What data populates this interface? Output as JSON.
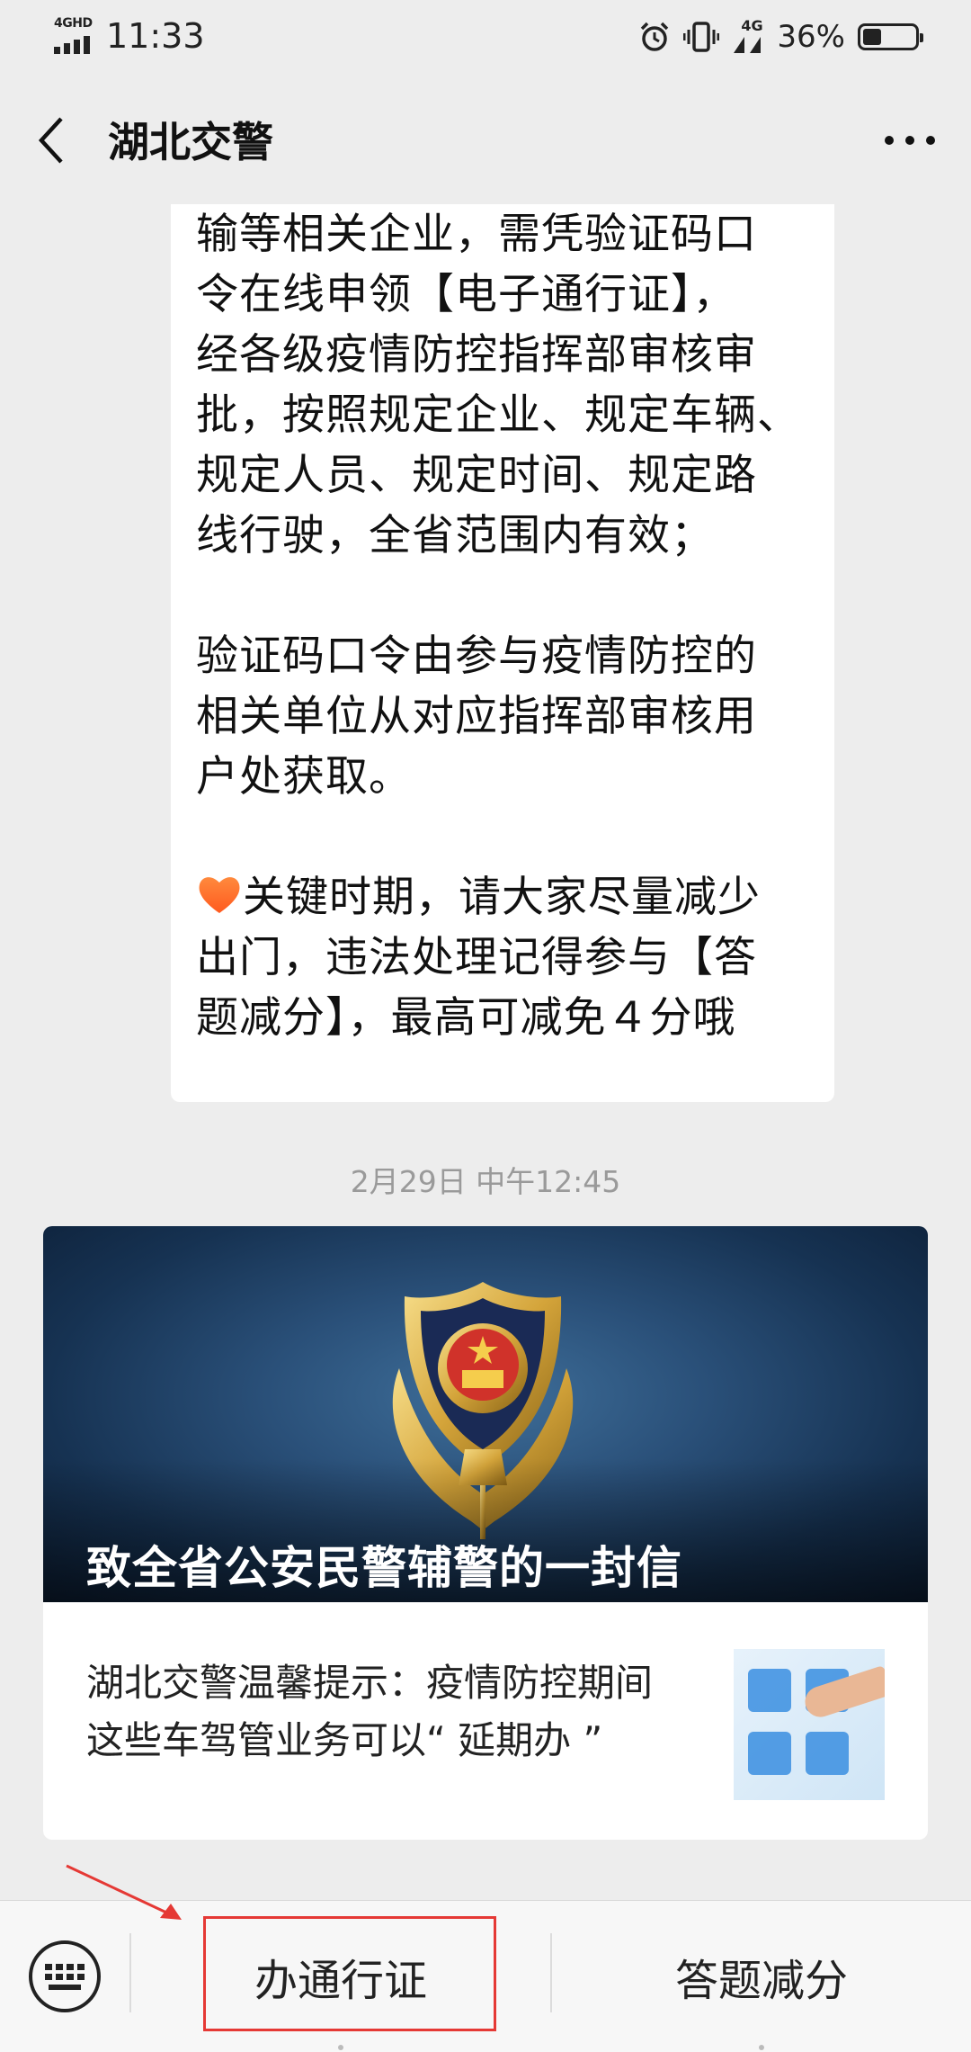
{
  "status_bar": {
    "network_label": "4GHD",
    "time": "11:33",
    "signal_label": "4G",
    "battery_percent": "36%",
    "battery_level": 0.36,
    "icons": [
      "alarm-icon",
      "vibrate-icon",
      "signal-icon",
      "battery-icon"
    ]
  },
  "nav": {
    "title": "湖北交警"
  },
  "message": {
    "lines": [
      "输等相关企业，需凭验证码口",
      "令在线申领【电子通行证】，",
      "经各级疫情防控指挥部审核审",
      "批，按照规定企业、规定车辆、",
      "规定人员、规定时间、规定路",
      "线行驶，全省范围内有效；"
    ],
    "para2_lines": [
      " 验证码口令由参与疫情防控的",
      "相关单位从对应指挥部审核用",
      "户处获取。"
    ],
    "para3_first": "关键时期，请大家尽量减少",
    "para3_lines": [
      "出门，违法处理记得参与【答",
      "题减分】，最高可减免４分哦"
    ]
  },
  "timestamp": "2月29日 中午12:45",
  "article": {
    "cover_title": "致全省公安民警辅警的一封信",
    "sub_title_line1": "湖北交警温馨提示：疫情防控期间",
    "sub_title_line2": "这些车驾管业务可以“ 延期办 ”"
  },
  "bottom_menu": {
    "items": [
      "办通行证",
      "答题减分"
    ]
  },
  "colors": {
    "background": "#ededed",
    "highlight": "#e53935"
  }
}
